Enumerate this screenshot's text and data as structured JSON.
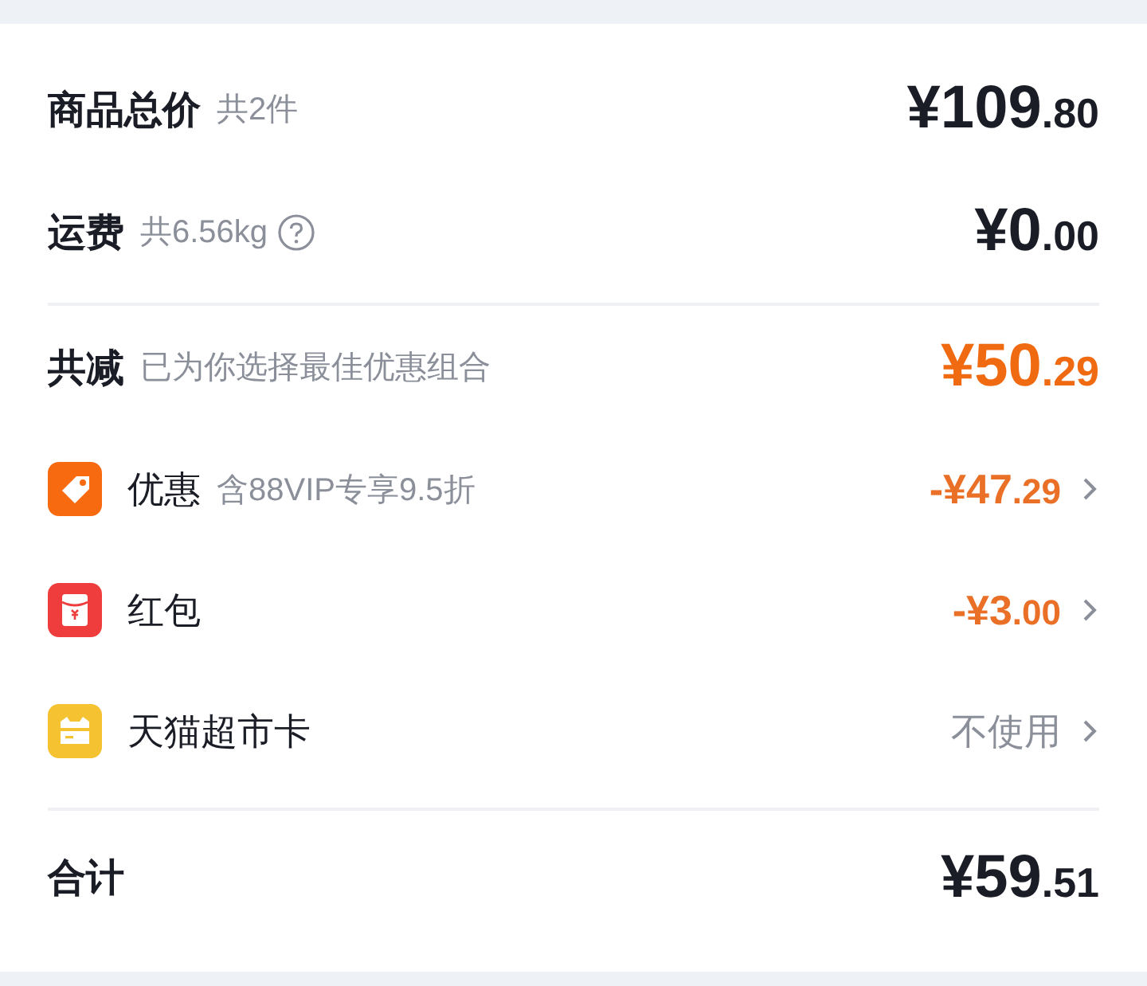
{
  "summary": [
    {
      "label": "商品总价",
      "note": "共2件",
      "help": false,
      "price": "¥109.80",
      "highlight": false
    },
    {
      "label": "运费",
      "note": "共6.56kg",
      "help": true,
      "price": "¥0.00",
      "highlight": false
    }
  ],
  "savings": {
    "label": "共减",
    "note": "已为你选择最佳优惠组合",
    "price": "¥50.29",
    "highlight": true
  },
  "items": [
    {
      "kind": "tag",
      "label": "优惠",
      "note": "含88VIP专享9.5折",
      "value": "-¥47.29",
      "highlight": true
    },
    {
      "kind": "packet",
      "label": "红包",
      "value": "-¥3.00",
      "highlight": true
    },
    {
      "kind": "card",
      "label": "天猫超市卡",
      "value": "不使用",
      "highlight": false
    }
  ],
  "total": {
    "label": "合计",
    "price": "¥59.51",
    "highlight": false
  }
}
